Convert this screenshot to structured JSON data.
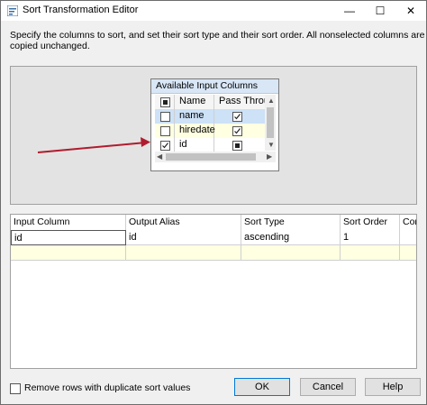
{
  "window": {
    "title": "Sort Transformation Editor",
    "minimize_glyph": "—",
    "maximize_glyph": "☐",
    "close_glyph": "✕"
  },
  "description": "Specify the columns to sort, and set their sort type and their sort order. All nonselected columns are copied unchanged.",
  "available_columns": {
    "header": "Available Input Columns",
    "col_name": "Name",
    "col_pass": "Pass Throu...",
    "rows": [
      {
        "name": "name",
        "selected": false,
        "pass_through": true,
        "pass_state": "checked"
      },
      {
        "name": "hiredate",
        "selected": false,
        "pass_through": true,
        "pass_state": "checked"
      },
      {
        "name": "id",
        "selected": true,
        "pass_through": true,
        "pass_state": "filled"
      }
    ]
  },
  "sort_grid": {
    "columns": [
      "Input Column",
      "Output Alias",
      "Sort Type",
      "Sort Order",
      "Com"
    ],
    "rows": [
      {
        "input_column": "id",
        "output_alias": "id",
        "sort_type": "ascending",
        "sort_order": "1",
        "comparison": ""
      }
    ]
  },
  "remove_duplicates": {
    "label": "Remove rows with duplicate sort values",
    "checked": false
  },
  "buttons": {
    "ok": "OK",
    "cancel": "Cancel",
    "help": "Help"
  },
  "colors": {
    "selected_row": "#cde1f7",
    "new_row": "#ffffe1",
    "arrow": "#b01c2e"
  }
}
